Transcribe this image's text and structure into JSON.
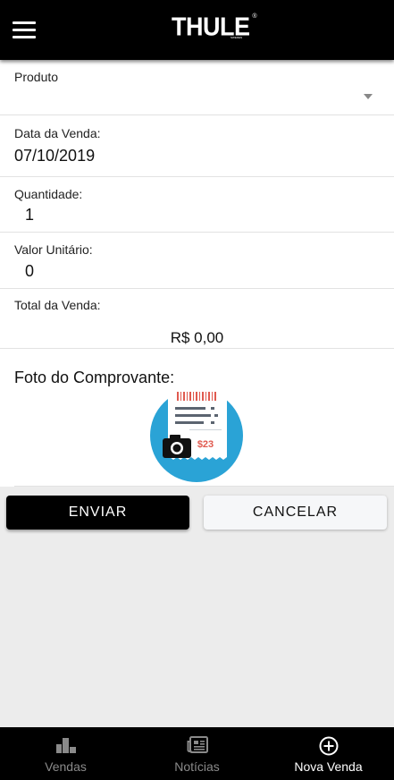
{
  "header": {
    "logo_text": "THULE",
    "logo_registered": "®",
    "logo_sub": "SWEDEN",
    "menu_icon": "hamburger-menu-icon"
  },
  "form": {
    "produto": {
      "label": "Produto",
      "value": ""
    },
    "data_venda": {
      "label": "Data da Venda:",
      "value": "07/10/2019"
    },
    "quantidade": {
      "label": "Quantidade:",
      "value": "1"
    },
    "valor_unitario": {
      "label": "Valor Unitário:",
      "value": "0"
    },
    "total_venda": {
      "label": "Total da Venda:",
      "value": "R$ 0,00"
    },
    "foto": {
      "label": "Foto do Comprovante:",
      "receipt_amount": "$23",
      "icon": "camera-receipt-icon"
    }
  },
  "actions": {
    "submit_label": "ENVIAR",
    "cancel_label": "CANCELAR"
  },
  "tabbar": {
    "tabs": [
      {
        "label": "Vendas",
        "icon": "bar-chart-icon",
        "active": false
      },
      {
        "label": "Notícias",
        "icon": "newspaper-icon",
        "active": false
      },
      {
        "label": "Nova Venda",
        "icon": "plus-circle-icon",
        "active": true
      }
    ]
  },
  "colors": {
    "header_bg": "#000000",
    "receipt_circle": "#2aa3d6",
    "receipt_accent": "#e05a4f",
    "tab_active": "#ffffff",
    "tab_inactive": "#8a8a8a"
  }
}
